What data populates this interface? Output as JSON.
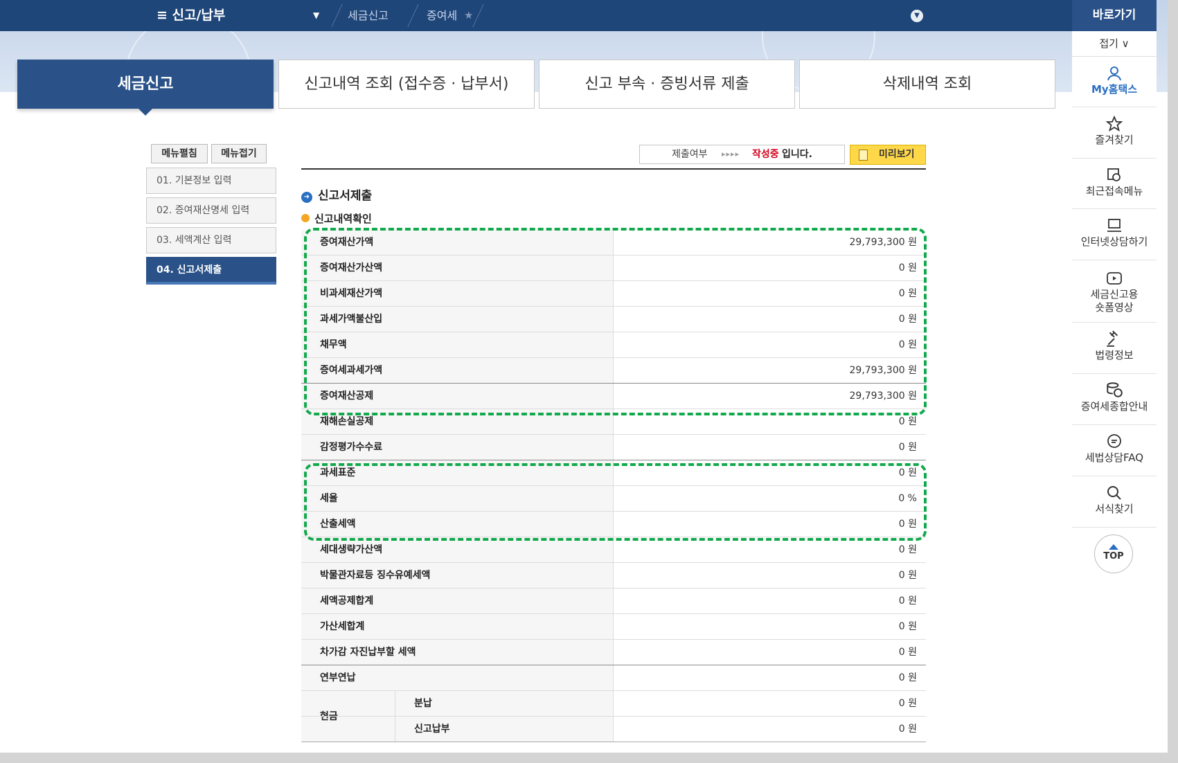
{
  "topbar": {
    "menu_label": "≡  신고/납부",
    "crumbs": [
      "세금신고",
      "증여세"
    ],
    "quick_title": "바로가기",
    "fold_label": "접기 ∨"
  },
  "tabs": [
    {
      "label": "세금신고"
    },
    {
      "label": "신고내역 조회 (접수증 · 납부서)"
    },
    {
      "label": "신고 부속 · 증빙서류 제출"
    },
    {
      "label": "삭제내역 조회"
    }
  ],
  "side": {
    "expand_label": "메뉴펼침",
    "collapse_label": "메뉴접기",
    "steps": [
      {
        "label": "01. 기본정보 입력"
      },
      {
        "label": "02. 증여재산명세 입력"
      },
      {
        "label": "03. 세액계산 입력"
      },
      {
        "label": "04. 신고서제출"
      }
    ]
  },
  "status": {
    "label": "제출여부",
    "state": "작성중",
    "suffix": "입니다.",
    "preview_label": "미리보기"
  },
  "section": {
    "title": "신고서제출",
    "subtitle": "신고내역확인"
  },
  "rows": [
    {
      "k": "증여재산가액",
      "v": "29,793,300 원"
    },
    {
      "k": "증여재산가산액",
      "v": "0 원"
    },
    {
      "k": "비과세재산가액",
      "v": "0 원"
    },
    {
      "k": "과세가액불산입",
      "v": "0 원"
    },
    {
      "k": "채무액",
      "v": "0 원"
    },
    {
      "k": "증여세과세가액",
      "v": "29,793,300 원"
    },
    {
      "k": "증여재산공제",
      "v": "29,793,300 원"
    },
    {
      "k": "재해손실공제",
      "v": "0 원"
    },
    {
      "k": "감정평가수수료",
      "v": "0 원"
    },
    {
      "k": "과세표준",
      "v": "0 원"
    },
    {
      "k": "세율",
      "v": "0 %"
    },
    {
      "k": "산출세액",
      "v": "0 원"
    },
    {
      "k": "세대생략가산액",
      "v": "0 원"
    },
    {
      "k": "박물관자료등 징수유예세액",
      "v": "0 원"
    },
    {
      "k": "세액공제합계",
      "v": "0 원"
    },
    {
      "k": "가산세합계",
      "v": "0 원"
    },
    {
      "k": "차가감 자진납부할 세액",
      "v": "0 원"
    },
    {
      "k": "연부연납",
      "v": "0 원"
    }
  ],
  "cash": {
    "label": "현금",
    "subs": [
      {
        "k": "분납",
        "v": "0 원"
      },
      {
        "k": "신고납부",
        "v": "0 원"
      }
    ]
  },
  "quick": {
    "items": [
      {
        "label": "My홈택스",
        "icon": "person-icon"
      },
      {
        "label": "즐겨찾기",
        "icon": "star-icon"
      },
      {
        "label": "최근접속메뉴",
        "icon": "recent-icon"
      },
      {
        "label": "인터넷상담하기",
        "icon": "monitor-icon"
      },
      {
        "label": "세금신고용 숏폼영상",
        "icon": "play-icon"
      },
      {
        "label": "법령정보",
        "icon": "gavel-icon"
      },
      {
        "label": "증여세종합안내",
        "icon": "coins-icon"
      },
      {
        "label": "세법상담FAQ",
        "icon": "chat-icon"
      },
      {
        "label": "서식찾기",
        "icon": "search-icon"
      }
    ],
    "top_label": "TOP"
  },
  "colors": {
    "primary": "#2a5288",
    "highlight_dash": "#12a94c",
    "status_red": "#d0021b",
    "preview_yellow": "#ffd84a"
  }
}
